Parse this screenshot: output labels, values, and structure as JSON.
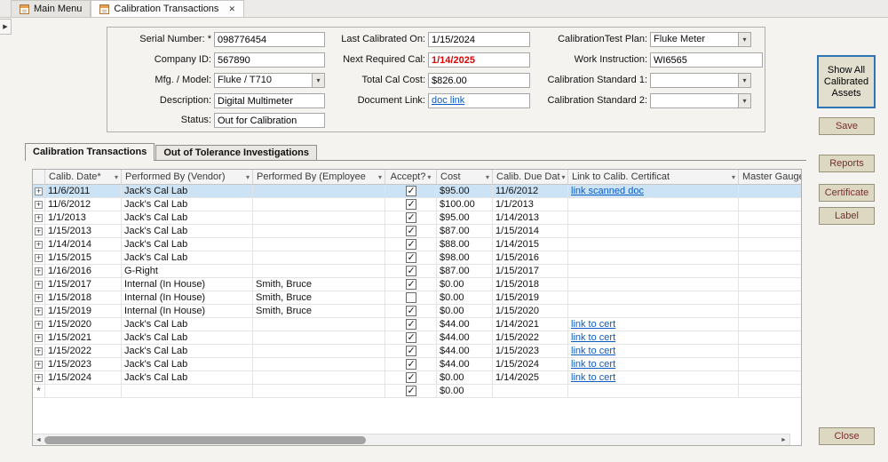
{
  "tabbar": {
    "tabs": [
      {
        "label": "Main Menu"
      },
      {
        "label": "Calibration Transactions"
      }
    ]
  },
  "form": {
    "serial_number": {
      "label": "Serial Number: *",
      "value": "098776454"
    },
    "company_id": {
      "label": "Company ID:",
      "value": "567890"
    },
    "mfg_model": {
      "label": "Mfg. / Model:",
      "value": "Fluke / T710"
    },
    "description": {
      "label": "Description:",
      "value": "Digital Multimeter"
    },
    "status": {
      "label": "Status:",
      "value": "Out for Calibration"
    },
    "last_calibrated": {
      "label": "Last Calibrated On:",
      "value": "1/15/2024"
    },
    "next_required": {
      "label": "Next Required Cal:",
      "value": "1/14/2025",
      "color": "#e00000"
    },
    "total_cost": {
      "label": "Total Cal Cost:",
      "value": "$826.00"
    },
    "document_link": {
      "label": "Document Link:",
      "value": "doc link"
    },
    "test_plan": {
      "label": "CalibrationTest Plan:",
      "value": "Fluke Meter"
    },
    "work_instruction": {
      "label": "Work Instruction:",
      "value": "WI6565"
    },
    "cal_standard_1": {
      "label": "Calibration Standard 1:",
      "value": ""
    },
    "cal_standard_2": {
      "label": "Calibration Standard 2:",
      "value": ""
    }
  },
  "buttons": {
    "show_all": "Show All Calibrated Assets",
    "save": "Save",
    "reports": "Reports",
    "certificate": "Certificate",
    "label": "Label",
    "close": "Close"
  },
  "subtabs": [
    {
      "label": "Calibration Transactions"
    },
    {
      "label": "Out of Tolerance Investigations"
    }
  ],
  "grid": {
    "columns": [
      "Calib. Date*",
      "Performed By (Vendor)",
      "Performed By (Employee",
      "Accept?",
      "Cost",
      "Calib. Due Dat",
      "Link to Calib. Certificat",
      "Master Gauges"
    ],
    "rows": [
      {
        "date": "11/6/2011",
        "vendor": "Jack's Cal Lab",
        "employee": "",
        "accept": true,
        "cost": "$95.00",
        "due": "11/6/2012",
        "link": "link scanned doc",
        "selected": true
      },
      {
        "date": "11/6/2012",
        "vendor": "Jack's Cal Lab",
        "employee": "",
        "accept": true,
        "cost": "$100.00",
        "due": "1/1/2013",
        "link": ""
      },
      {
        "date": "1/1/2013",
        "vendor": "Jack's Cal Lab",
        "employee": "",
        "accept": true,
        "cost": "$95.00",
        "due": "1/14/2013",
        "link": ""
      },
      {
        "date": "1/15/2013",
        "vendor": "Jack's Cal Lab",
        "employee": "",
        "accept": true,
        "cost": "$87.00",
        "due": "1/15/2014",
        "link": ""
      },
      {
        "date": "1/14/2014",
        "vendor": "Jack's Cal Lab",
        "employee": "",
        "accept": true,
        "cost": "$88.00",
        "due": "1/14/2015",
        "link": ""
      },
      {
        "date": "1/15/2015",
        "vendor": "Jack's Cal Lab",
        "employee": "",
        "accept": true,
        "cost": "$98.00",
        "due": "1/15/2016",
        "link": ""
      },
      {
        "date": "1/16/2016",
        "vendor": "G-Right",
        "employee": "",
        "accept": true,
        "cost": "$87.00",
        "due": "1/15/2017",
        "link": ""
      },
      {
        "date": "1/15/2017",
        "vendor": "Internal (In House)",
        "employee": "Smith, Bruce",
        "accept": true,
        "cost": "$0.00",
        "due": "1/15/2018",
        "link": ""
      },
      {
        "date": "1/15/2018",
        "vendor": "Internal (In House)",
        "employee": "Smith, Bruce",
        "accept": false,
        "cost": "$0.00",
        "due": "1/15/2019",
        "link": ""
      },
      {
        "date": "1/15/2019",
        "vendor": "Internal (In House)",
        "employee": "Smith, Bruce",
        "accept": true,
        "cost": "$0.00",
        "due": "1/15/2020",
        "link": ""
      },
      {
        "date": "1/15/2020",
        "vendor": "Jack's Cal Lab",
        "employee": "",
        "accept": true,
        "cost": "$44.00",
        "due": "1/14/2021",
        "link": "link to cert"
      },
      {
        "date": "1/15/2021",
        "vendor": "Jack's Cal Lab",
        "employee": "",
        "accept": true,
        "cost": "$44.00",
        "due": "1/15/2022",
        "link": "link to cert"
      },
      {
        "date": "1/15/2022",
        "vendor": "Jack's Cal Lab",
        "employee": "",
        "accept": true,
        "cost": "$44.00",
        "due": "1/15/2023",
        "link": "link to cert"
      },
      {
        "date": "1/15/2023",
        "vendor": "Jack's Cal Lab",
        "employee": "",
        "accept": true,
        "cost": "$44.00",
        "due": "1/15/2024",
        "link": "link to cert"
      },
      {
        "date": "1/15/2024",
        "vendor": "Jack's Cal Lab",
        "employee": "",
        "accept": true,
        "cost": "$0.00",
        "due": "1/14/2025",
        "link": "link to cert"
      }
    ],
    "new_row": {
      "accept": true,
      "cost": "$0.00"
    }
  }
}
